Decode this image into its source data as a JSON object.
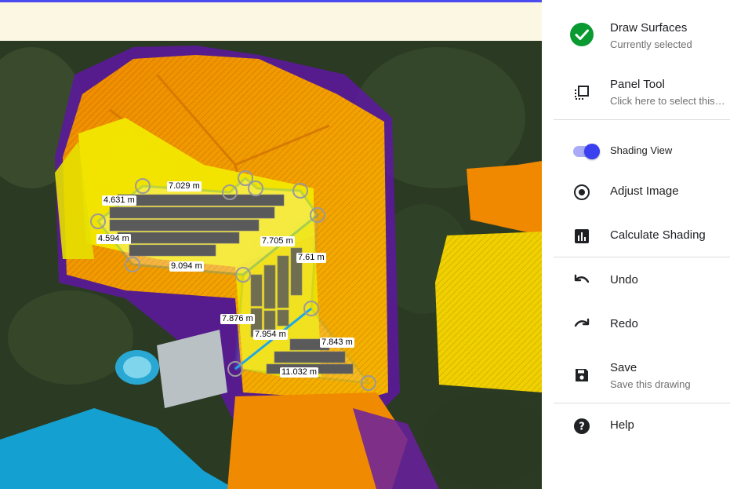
{
  "colors": {
    "accent": "#4b4cf0",
    "banner_bg": "#fbf7e3",
    "check_green": "#0a9a32",
    "outline_blue": "#1fa7e6",
    "shading_high": "#f5f000",
    "shading_mid": "#f59a00",
    "shading_low": "#6a1fa0",
    "panel_row": "#5e5e5e"
  },
  "map": {
    "segment_labels": [
      {
        "text": "7.029 m"
      },
      {
        "text": "4.631 m"
      },
      {
        "text": "4.594 m"
      },
      {
        "text": "9.094 m"
      },
      {
        "text": "7.705 m"
      },
      {
        "text": "7.61 m"
      },
      {
        "text": "7.876 m"
      },
      {
        "text": "7.954 m"
      },
      {
        "text": "7.843 m"
      },
      {
        "text": "11.032 m"
      }
    ]
  },
  "menu": {
    "draw_surfaces": {
      "title": "Draw Surfaces",
      "subtitle": "Currently selected",
      "icon": "check-circle-icon"
    },
    "panel_tool": {
      "title": "Panel Tool",
      "subtitle": "Click here to select this tool",
      "icon": "panel-select-icon"
    },
    "shading_view": {
      "title": "Shading View",
      "enabled": true,
      "icon": "toggle-switch"
    },
    "adjust_image": {
      "title": "Adjust Image",
      "icon": "radio-target-icon"
    },
    "calculate_shading": {
      "title": "Calculate Shading",
      "icon": "bar-chart-icon"
    },
    "undo": {
      "title": "Undo",
      "icon": "undo-icon"
    },
    "redo": {
      "title": "Redo",
      "icon": "redo-icon"
    },
    "save": {
      "title": "Save",
      "subtitle": "Save this drawing",
      "icon": "floppy-disk-icon"
    },
    "help": {
      "title": "Help",
      "icon": "help-circle-icon"
    }
  }
}
